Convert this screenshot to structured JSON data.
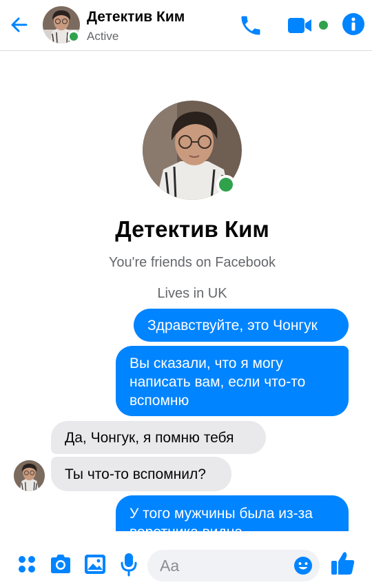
{
  "colors": {
    "accent": "#0084ff",
    "online": "#31a24c",
    "incoming_bubble": "#e9e9eb",
    "muted_text": "#65676b"
  },
  "header": {
    "back_icon": "arrow-left-icon",
    "contact_name": "Детектив Ким",
    "status": "Active",
    "actions": [
      "phone-icon",
      "video-camera-icon",
      "info-icon"
    ]
  },
  "profile": {
    "name": "Детектив Ким",
    "friends_note": "You're friends on Facebook",
    "location": "Lives in UK"
  },
  "messages": [
    {
      "from": "me",
      "text": "Здравствуйте, это Чонгук"
    },
    {
      "from": "me",
      "text": "Вы сказали, что я могу написать вам, если что-то вспомню"
    },
    {
      "from": "contact",
      "text": "Да, Чонгук, я помню тебя"
    },
    {
      "from": "contact",
      "text": "Ты что-то вспомнил?"
    },
    {
      "from": "me",
      "text": "У того мужчины была из-за воротника видна"
    }
  ],
  "composer": {
    "placeholder": "Aa",
    "icons": [
      "menu-dots-icon",
      "camera-icon",
      "image-icon",
      "microphone-icon",
      "emoji-icon",
      "thumbs-up-icon"
    ]
  }
}
